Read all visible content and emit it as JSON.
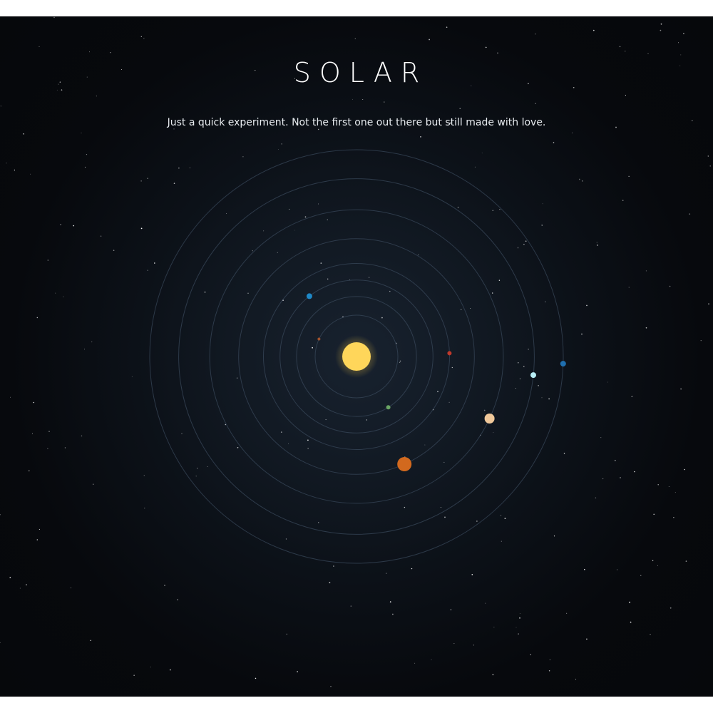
{
  "header": {
    "title": "SOLAR",
    "subtitle": "Just a quick experiment. Not the first one out there but still made with love."
  },
  "colors": {
    "sun": "#ffd65a",
    "orbit": "#3a4a5c"
  },
  "planets": [
    {
      "name": "mercury",
      "color": "#a0522d",
      "orbit": 0.2,
      "angle": 205,
      "size": 2
    },
    {
      "name": "venus",
      "color": "#6aa564",
      "orbit": 0.29,
      "angle": 58,
      "size": 3
    },
    {
      "name": "earth",
      "color": "#1e88c7",
      "orbit": 0.37,
      "angle": 232,
      "size": 4
    },
    {
      "name": "mars",
      "color": "#c0392b",
      "orbit": 0.45,
      "angle": 358,
      "size": 3
    },
    {
      "name": "jupiter",
      "color": "#d2691e",
      "orbit": 0.57,
      "angle": 66,
      "size": 10
    },
    {
      "name": "saturn",
      "color": "#f0c89a",
      "orbit": 0.71,
      "angle": 25,
      "size": 7
    },
    {
      "name": "uranus",
      "color": "#b8eef5",
      "orbit": 0.86,
      "angle": 6,
      "size": 4
    },
    {
      "name": "neptune",
      "color": "#1f6fb0",
      "orbit": 1.0,
      "angle": 2,
      "size": 4
    }
  ]
}
